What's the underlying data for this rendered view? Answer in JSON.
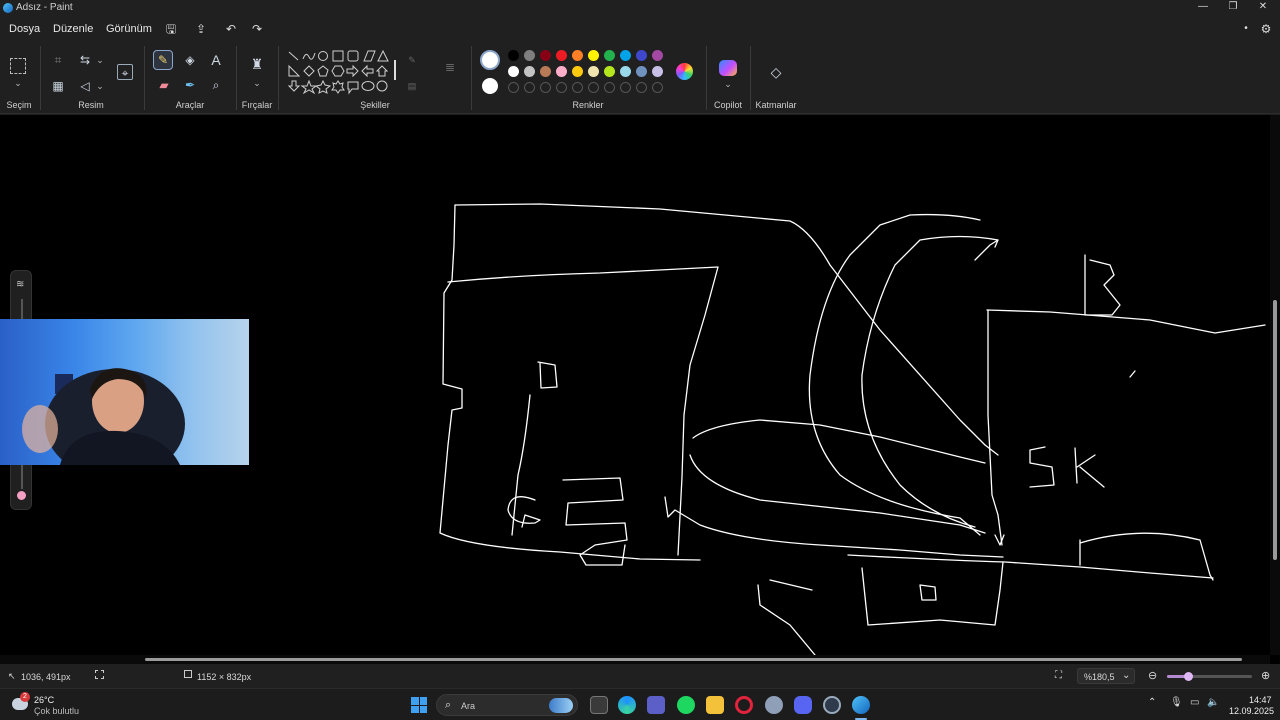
{
  "window": {
    "title": "Adsız - Paint"
  },
  "menu": {
    "file": "Dosya",
    "edit": "Düzenle",
    "view": "Görünüm"
  },
  "ribbon": {
    "groups": {
      "selection": "Seçim",
      "image": "Resim",
      "tools": "Araçlar",
      "brushes": "Fırçalar",
      "shapes": "Şekiller",
      "colors": "Renkler",
      "copilot": "Copilot",
      "layers": "Katmanlar"
    },
    "palette_row1": [
      "#000000",
      "#7f7f7f",
      "#880015",
      "#ed1c24",
      "#ff7f27",
      "#fff200",
      "#22b14c",
      "#00a2e8",
      "#3f48cc",
      "#a349a4"
    ],
    "palette_row2": [
      "#ffffff",
      "#c3c3c3",
      "#b97a57",
      "#ffaec9",
      "#ffc90e",
      "#efe4b0",
      "#b5e61d",
      "#99d9ea",
      "#7092be",
      "#c8bfe7"
    ],
    "primary_color": "#ffffff",
    "secondary_color": "#ffffff"
  },
  "status": {
    "cursor_pos": "1036, 491px",
    "canvas_size": "1152 × 832px",
    "zoom": "%180,5"
  },
  "taskbar": {
    "weather_temp": "26°C",
    "weather_desc": "Çok bulutlu",
    "search_placeholder": "Ara",
    "time": "14:47",
    "date": "12.09.2025",
    "badge_count": "2"
  }
}
